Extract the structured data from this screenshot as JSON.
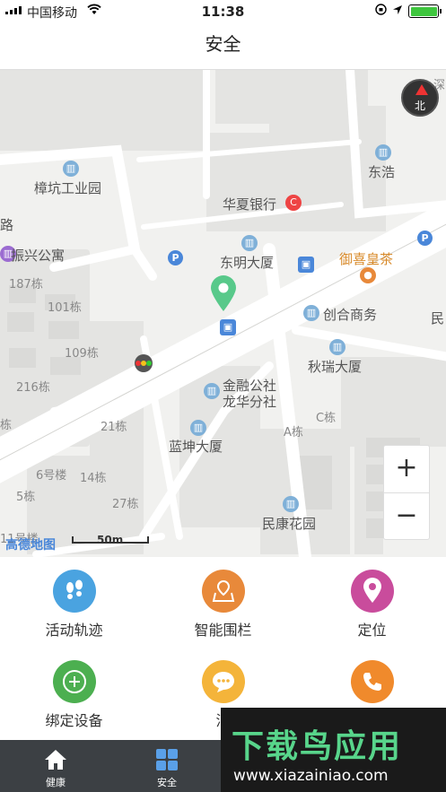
{
  "status_bar": {
    "carrier": "中国移动",
    "time": "11:38"
  },
  "nav": {
    "title": "安全"
  },
  "map": {
    "labels": {
      "zhangkeng": "樟坑工业园",
      "huaxia": "华夏银行",
      "donghao": "东浩",
      "dongming": "东明大厦",
      "yuxi": "御喜皇茶",
      "chuanghe": "创合商务",
      "min": "民",
      "qiurui": "秋瑞大厦",
      "jinrong1": "金融公社",
      "jinrong2": "龙华分社",
      "lankun": "蓝坤大厦",
      "minkang": "民康花园",
      "zhenxing": "振兴公寓",
      "lu": "路",
      "shen": "深",
      "b187": "187栋",
      "b101": "101栋",
      "b109": "109栋",
      "b216": "216栋",
      "b21": "21栋",
      "b6": "6号楼",
      "b14": "14栋",
      "b5": "5栋",
      "b27": "27栋",
      "b11": "11号楼",
      "bA": "A栋",
      "bC": "C栋",
      "dong": "栋"
    },
    "compass": "北",
    "zoom_in": "+",
    "zoom_out": "−",
    "scale": "50m",
    "logo": "高德地图"
  },
  "actions": [
    {
      "label": "活动轨迹",
      "icon": "footprints-icon",
      "color": "#4aa3e0"
    },
    {
      "label": "智能围栏",
      "icon": "map-pin-fence-icon",
      "color": "#e8893a"
    },
    {
      "label": "定位",
      "icon": "location-icon",
      "color": "#c94c9c"
    },
    {
      "label": "绑定设备",
      "icon": "plus-circle-icon",
      "color": "#4caf50"
    },
    {
      "label": "消",
      "icon": "chat-icon",
      "color": "#f4b43a"
    },
    {
      "label": "",
      "icon": "phone-icon",
      "color": "#f08a2c"
    }
  ],
  "tabs": [
    {
      "label": "健康",
      "icon": "home-icon"
    },
    {
      "label": "安全",
      "icon": "grid-icon"
    }
  ],
  "watermark": {
    "text": "下载鸟应用",
    "url": "www.xiazainiao.com"
  }
}
